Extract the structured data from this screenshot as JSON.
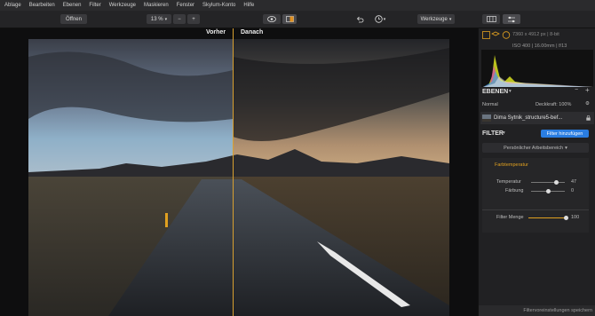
{
  "menu": [
    "Ablage",
    "Bearbeiten",
    "Ebenen",
    "Filter",
    "Werkzeuge",
    "Maskieren",
    "Fenster",
    "Skylum-Konto",
    "Hilfe"
  ],
  "toolbar": {
    "open_label": "Öffnen",
    "zoom_value": "13 %",
    "zoom_minus": "−",
    "zoom_plus": "+",
    "tools_label": "Werkzeuge"
  },
  "canvas": {
    "before_label": "Vorher",
    "after_label": "Danach"
  },
  "panel": {
    "image_info": "7360 x 4912 px  |  8-bit",
    "exif": "ISO 400  |  16.00mm  |  f/13",
    "layers_title": "EBENEN",
    "blend_mode": "Normal",
    "opacity": "Deckkraft: 100%",
    "layer_name": "Dima Sytnik_structure5-bef...",
    "filter_title": "FILTER",
    "add_filter": "Filter hinzufügen",
    "workspace": "Persönlicher Arbeitsbereich",
    "filter_name": "Farbtemperatur",
    "temperature_label": "Temperatur",
    "temperature_value": "47",
    "tint_label": "Färbung",
    "tint_value": "0",
    "amount_label": "Filter Menge",
    "amount_value": "100",
    "save_preset": "Filtervoreinstellungen speichern"
  },
  "colors": {
    "accent": "#2a7de1",
    "divider": "#d8a030",
    "filter_header": "#e0a020"
  }
}
